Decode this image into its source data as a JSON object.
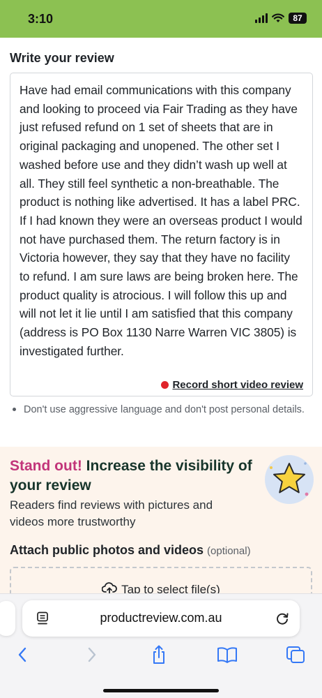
{
  "status_bar": {
    "time": "3:10",
    "battery": "87"
  },
  "form": {
    "section_title": "Write your review",
    "review_text": "Have had email communications with this company and looking to proceed via Fair Trading as they have just refused refund on 1 set of sheets that are in original packaging and unopened. The other set I washed before use and they didn’t wash up well at all. They still feel synthetic a non-breathable. The product is nothing like advertised. It has a label PRC. If I had known they were an overseas product I would not have purchased them. The return factory is in Victoria however, they say that they have no facility to refund. I am sure laws are being broken here. The product quality is atrocious. I will follow this up and will not let it lie until I am satisfied that this company (address is PO Box 1130 Narre Warren VIC 3805) is investigated further.",
    "record_link": "Record short video review",
    "guideline": "Don't use aggressive language and don't post personal details."
  },
  "promo": {
    "title_accent": "Stand out!",
    "title_rest": "Increase the visibility of your review",
    "subtitle": "Readers find reviews with pictures and videos more trustworthy",
    "attach_label": "Attach public photos and videos",
    "attach_optional": "(optional)",
    "dropzone_label": "Tap to select file(s)"
  },
  "browser": {
    "url": "productreview.com.au"
  },
  "colors": {
    "status_bar": "#8cc152",
    "accent_pink": "#c2357a",
    "heading_green": "#17352b",
    "record_red": "#e0242a",
    "link_blue": "#3478f6"
  }
}
